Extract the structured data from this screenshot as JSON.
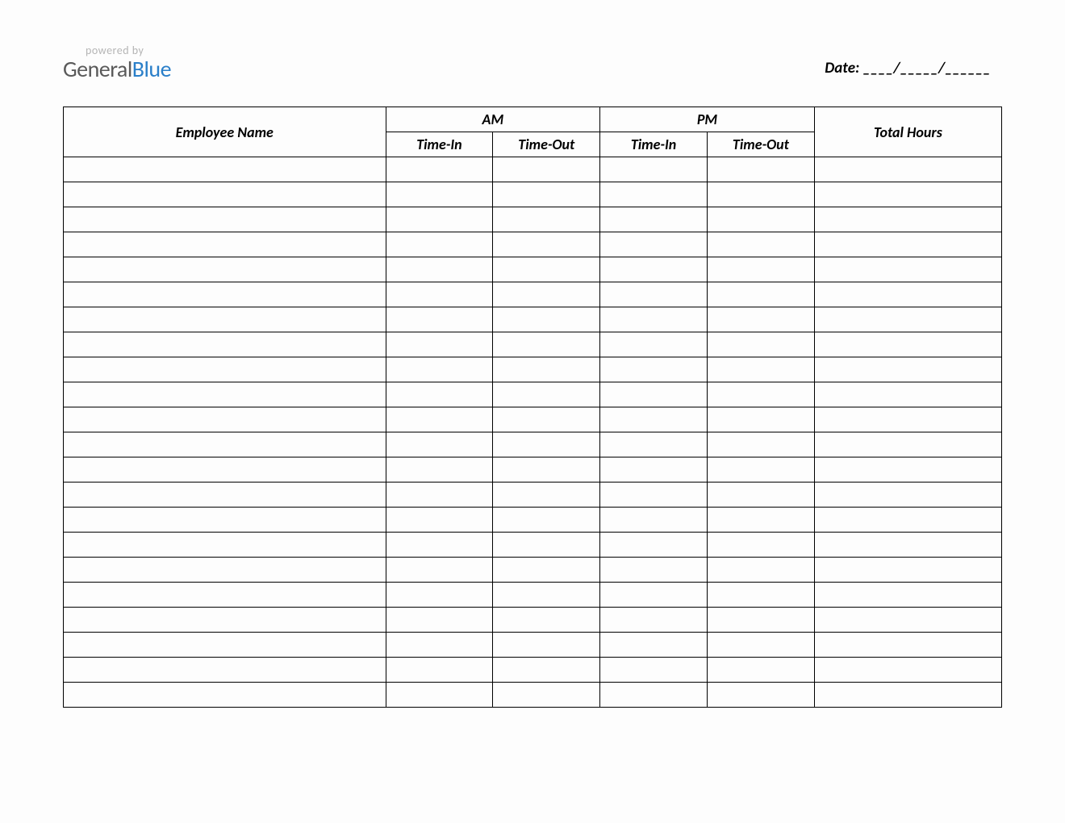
{
  "logo": {
    "powered_by": "powered by",
    "brand_first": "General",
    "brand_second": "Blue"
  },
  "date": {
    "label": "Date: ____/_____/______"
  },
  "table": {
    "headers": {
      "employee_name": "Employee Name",
      "am": "AM",
      "pm": "PM",
      "total_hours": "Total Hours",
      "time_in": "Time-In",
      "time_out": "Time-Out"
    },
    "rows": [
      {
        "name": "",
        "am_in": "",
        "am_out": "",
        "pm_in": "",
        "pm_out": "",
        "total": ""
      },
      {
        "name": "",
        "am_in": "",
        "am_out": "",
        "pm_in": "",
        "pm_out": "",
        "total": ""
      },
      {
        "name": "",
        "am_in": "",
        "am_out": "",
        "pm_in": "",
        "pm_out": "",
        "total": ""
      },
      {
        "name": "",
        "am_in": "",
        "am_out": "",
        "pm_in": "",
        "pm_out": "",
        "total": ""
      },
      {
        "name": "",
        "am_in": "",
        "am_out": "",
        "pm_in": "",
        "pm_out": "",
        "total": ""
      },
      {
        "name": "",
        "am_in": "",
        "am_out": "",
        "pm_in": "",
        "pm_out": "",
        "total": ""
      },
      {
        "name": "",
        "am_in": "",
        "am_out": "",
        "pm_in": "",
        "pm_out": "",
        "total": ""
      },
      {
        "name": "",
        "am_in": "",
        "am_out": "",
        "pm_in": "",
        "pm_out": "",
        "total": ""
      },
      {
        "name": "",
        "am_in": "",
        "am_out": "",
        "pm_in": "",
        "pm_out": "",
        "total": ""
      },
      {
        "name": "",
        "am_in": "",
        "am_out": "",
        "pm_in": "",
        "pm_out": "",
        "total": ""
      },
      {
        "name": "",
        "am_in": "",
        "am_out": "",
        "pm_in": "",
        "pm_out": "",
        "total": ""
      },
      {
        "name": "",
        "am_in": "",
        "am_out": "",
        "pm_in": "",
        "pm_out": "",
        "total": ""
      },
      {
        "name": "",
        "am_in": "",
        "am_out": "",
        "pm_in": "",
        "pm_out": "",
        "total": ""
      },
      {
        "name": "",
        "am_in": "",
        "am_out": "",
        "pm_in": "",
        "pm_out": "",
        "total": ""
      },
      {
        "name": "",
        "am_in": "",
        "am_out": "",
        "pm_in": "",
        "pm_out": "",
        "total": ""
      },
      {
        "name": "",
        "am_in": "",
        "am_out": "",
        "pm_in": "",
        "pm_out": "",
        "total": ""
      },
      {
        "name": "",
        "am_in": "",
        "am_out": "",
        "pm_in": "",
        "pm_out": "",
        "total": ""
      },
      {
        "name": "",
        "am_in": "",
        "am_out": "",
        "pm_in": "",
        "pm_out": "",
        "total": ""
      },
      {
        "name": "",
        "am_in": "",
        "am_out": "",
        "pm_in": "",
        "pm_out": "",
        "total": ""
      },
      {
        "name": "",
        "am_in": "",
        "am_out": "",
        "pm_in": "",
        "pm_out": "",
        "total": ""
      },
      {
        "name": "",
        "am_in": "",
        "am_out": "",
        "pm_in": "",
        "pm_out": "",
        "total": ""
      },
      {
        "name": "",
        "am_in": "",
        "am_out": "",
        "pm_in": "",
        "pm_out": "",
        "total": ""
      }
    ]
  }
}
